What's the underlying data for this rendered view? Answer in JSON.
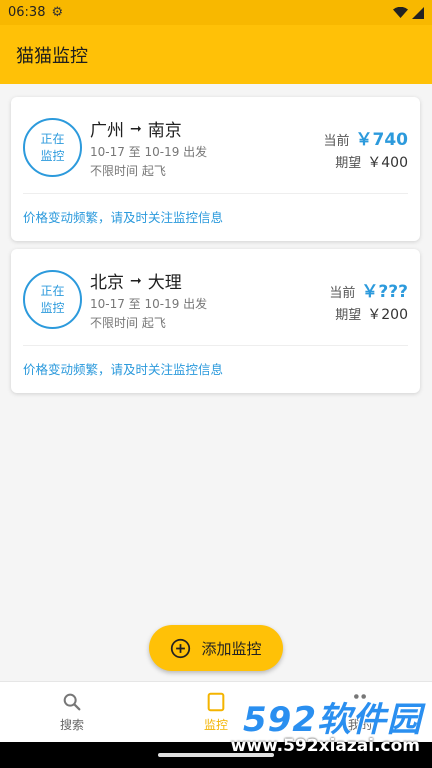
{
  "status_bar": {
    "time": "06:38"
  },
  "app_bar": {
    "title": "猫猫监控"
  },
  "monitors": [
    {
      "status_line1": "正在",
      "status_line2": "监控",
      "from": "广州",
      "to": "南京",
      "dates": "10-17 至 10-19   出发",
      "time_range": "不限时间   起飞",
      "current_label": "当前",
      "current_price": "￥740",
      "expected_label": "期望",
      "expected_price": "￥400",
      "notice": "价格变动频繁，请及时关注监控信息"
    },
    {
      "status_line1": "正在",
      "status_line2": "监控",
      "from": "北京",
      "to": "大理",
      "dates": "10-17 至 10-19   出发",
      "time_range": "不限时间   起飞",
      "current_label": "当前",
      "current_price": "￥???",
      "expected_label": "期望",
      "expected_price": "￥200",
      "notice": "价格变动频繁，请及时关注监控信息"
    }
  ],
  "fab": {
    "label": "添加监控"
  },
  "bottom_nav": [
    {
      "label": "搜索",
      "icon": "search-icon"
    },
    {
      "label": "监控",
      "icon": "monitor-icon"
    },
    {
      "label": "我的",
      "icon": "more-icon"
    }
  ],
  "watermark": {
    "line1": "592软件园",
    "line2": "www.592xiazai.com"
  },
  "colors": {
    "primary": "#ffc107",
    "status_bar": "#f8b800",
    "accent_blue": "#2c9adc"
  }
}
